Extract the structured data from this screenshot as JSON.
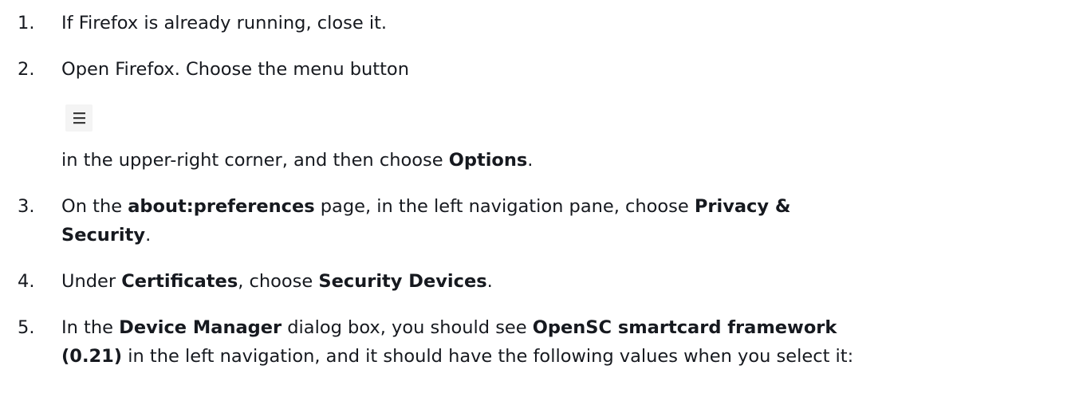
{
  "steps": [
    {
      "number": "1.",
      "parts": [
        "If Firefox is already running, close it."
      ]
    },
    {
      "number": "2.",
      "line1": "Open Firefox. Choose the menu button",
      "icon": "hamburger-menu-icon",
      "line2_a": "in the upper-right corner, and then choose ",
      "line2_b": "Options",
      "line2_c": "."
    },
    {
      "number": "3.",
      "a": "On the ",
      "b": "about:preferences",
      "c": " page, in the left navigation pane, choose ",
      "d": "Privacy &",
      "e": "Security",
      "f": "."
    },
    {
      "number": "4.",
      "a": "Under ",
      "b": "Certificates",
      "c": ", choose ",
      "d": "Security Devices",
      "e": "."
    },
    {
      "number": "5.",
      "a": "In the ",
      "b": "Device Manager",
      "c": " dialog box, you should see ",
      "d": "OpenSC smartcard framework",
      "e": "(0.21)",
      "f": " in the left navigation, and it should have the following values when you select it:"
    }
  ]
}
